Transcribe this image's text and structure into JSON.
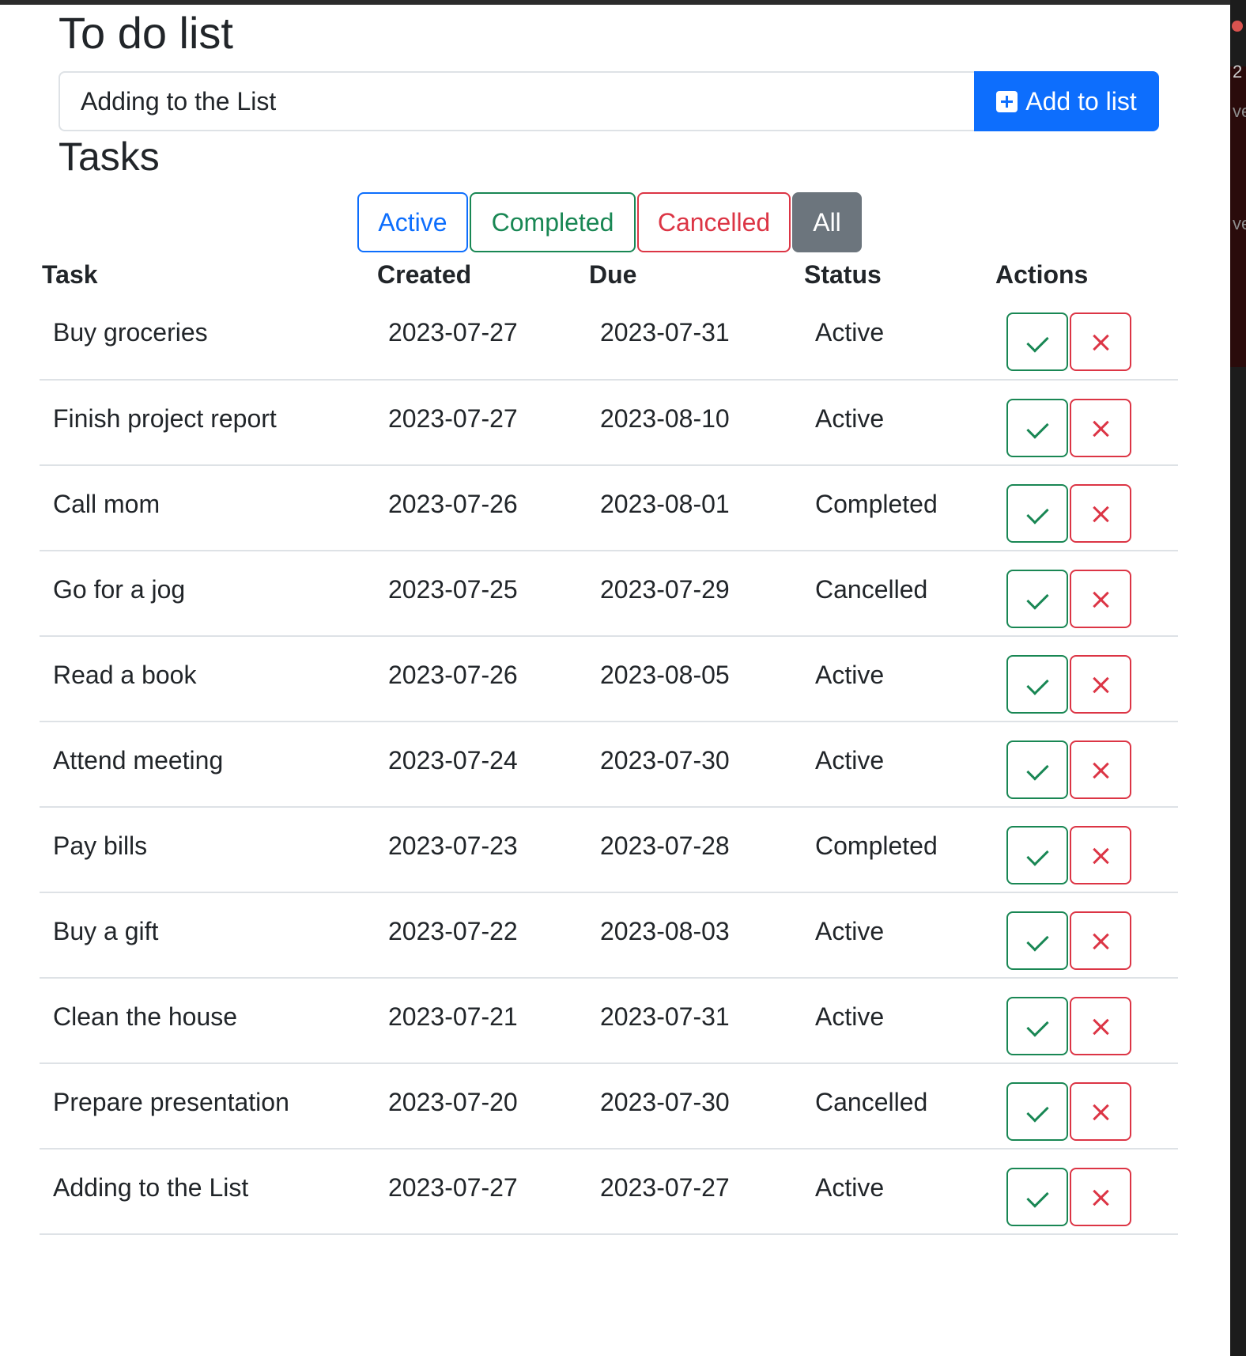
{
  "app": {
    "title": "To do list",
    "input_value": "Adding to the List",
    "add_button_label": "Add to list",
    "add_icon": "plus-square-icon"
  },
  "tasks_section": {
    "title": "Tasks",
    "filters": [
      {
        "label": "Active",
        "color": "#0d6efd"
      },
      {
        "label": "Completed",
        "color": "#198754"
      },
      {
        "label": "Cancelled",
        "color": "#dc3545"
      },
      {
        "label": "All",
        "color": "#6c757d",
        "selected": true
      }
    ]
  },
  "table": {
    "headers": [
      "Task",
      "Created",
      "Due",
      "Status",
      "Actions"
    ],
    "rows": [
      {
        "task": "Buy groceries",
        "created": "2023-07-27",
        "due": "2023-07-31",
        "status": "Active"
      },
      {
        "task": "Finish project report",
        "created": "2023-07-27",
        "due": "2023-08-10",
        "status": "Active"
      },
      {
        "task": "Call mom",
        "created": "2023-07-26",
        "due": "2023-08-01",
        "status": "Completed"
      },
      {
        "task": "Go for a jog",
        "created": "2023-07-25",
        "due": "2023-07-29",
        "status": "Cancelled"
      },
      {
        "task": "Read a book",
        "created": "2023-07-26",
        "due": "2023-08-05",
        "status": "Active"
      },
      {
        "task": "Attend meeting",
        "created": "2023-07-24",
        "due": "2023-07-30",
        "status": "Active"
      },
      {
        "task": "Pay bills",
        "created": "2023-07-23",
        "due": "2023-07-28",
        "status": "Completed"
      },
      {
        "task": "Buy a gift",
        "created": "2023-07-22",
        "due": "2023-08-03",
        "status": "Active"
      },
      {
        "task": "Clean the house",
        "created": "2023-07-21",
        "due": "2023-07-31",
        "status": "Active"
      },
      {
        "task": "Prepare presentation",
        "created": "2023-07-20",
        "due": "2023-07-30",
        "status": "Cancelled"
      },
      {
        "task": "Adding to the List",
        "created": "2023-07-27",
        "due": "2023-07-27",
        "status": "Active"
      }
    ],
    "action_icons": {
      "complete": "check-icon",
      "cancel": "x-icon"
    },
    "action_colors": {
      "complete": "#198754",
      "cancel": "#dc3545"
    }
  },
  "side_panel": {
    "fragments": [
      "2",
      "ve",
      "ve"
    ]
  }
}
